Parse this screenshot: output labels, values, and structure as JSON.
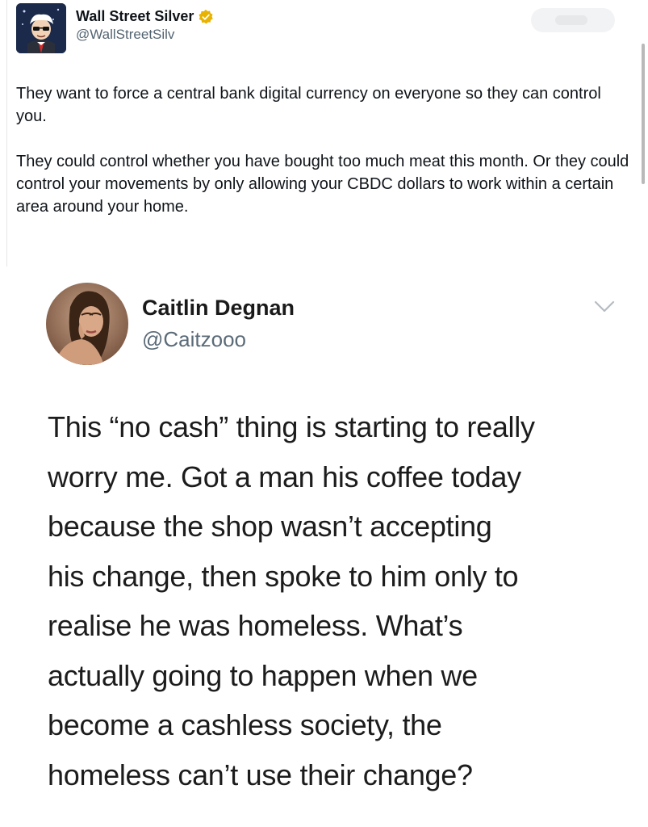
{
  "tweet": {
    "author": {
      "display_name": "Wall Street Silver",
      "handle": "@WallStreetSilv",
      "verified": true,
      "verified_color": "#e8b200",
      "avatar_icon": "wsb-guy-avatar-icon"
    },
    "paragraphs": [
      "They want to force a central bank digital currency on everyone so they can control you.",
      "They could control whether you have bought too much meat this month. Or they could control your movements by only allowing your CBDC dollars to work within a certain area around your home."
    ]
  },
  "embedded_tweet": {
    "author": {
      "display_name": "Caitlin Degnan",
      "handle": "@Caitzooo",
      "avatar_icon": "profile-photo-avatar-icon"
    },
    "menu_icon": "chevron-down-icon",
    "text_lines": [
      "This “no cash” thing is starting to really",
      "worry me. Got a man his coffee today",
      "because the shop wasn’t accepting",
      "his change, then spoke to him only to",
      "realise he was homeless. What’s",
      "actually going to happen when we",
      "become a cashless society, the",
      "homeless can’t use their change?"
    ]
  },
  "colors": {
    "text_primary": "#0f1419",
    "text_secondary": "#536471",
    "embed_text": "#1c1c1c"
  }
}
